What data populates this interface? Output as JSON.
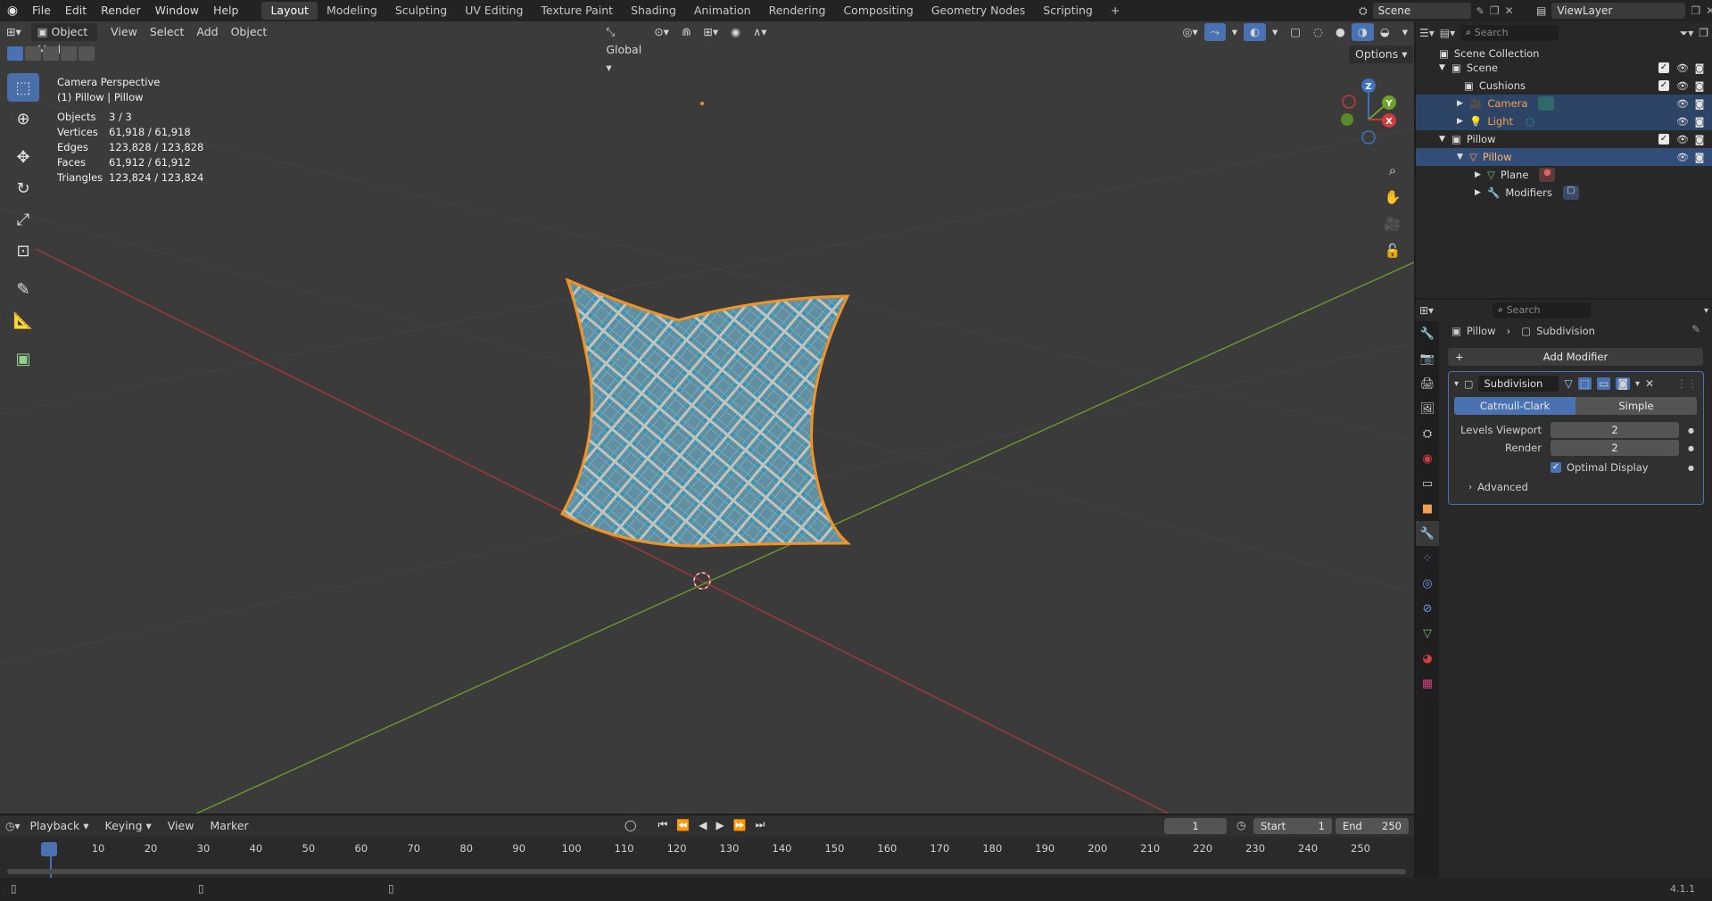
{
  "menu": [
    "File",
    "Edit",
    "Render",
    "Window",
    "Help"
  ],
  "workspaces": [
    "Layout",
    "Modeling",
    "Sculpting",
    "UV Editing",
    "Texture Paint",
    "Shading",
    "Animation",
    "Rendering",
    "Compositing",
    "Geometry Nodes",
    "Scripting"
  ],
  "active_workspace": "Layout",
  "plus_tab": "+",
  "scene_name": "Scene",
  "view_layer": "ViewLayer",
  "viewport": {
    "mode": "Object Mode",
    "menus": [
      "View",
      "Select",
      "Add",
      "Object"
    ],
    "transform_orientation": "Global",
    "options_label": "Options",
    "overlay_title": "Camera Perspective",
    "overlay_subtitle": "(1) Pillow | Pillow",
    "stats": [
      {
        "k": "Objects",
        "v": "3 / 3"
      },
      {
        "k": "Vertices",
        "v": "61,918 / 61,918"
      },
      {
        "k": "Edges",
        "v": "123,828 / 123,828"
      },
      {
        "k": "Faces",
        "v": "61,912 / 61,912"
      },
      {
        "k": "Triangles",
        "v": "123,824 / 123,824"
      }
    ],
    "gizmo_labels": {
      "z": "Z",
      "y": "Y",
      "x": "X"
    }
  },
  "outliner": {
    "search_placeholder": "Search",
    "root": "Scene Collection",
    "items": [
      {
        "label": "Scene"
      },
      {
        "label": "Cushions"
      },
      {
        "label": "Camera"
      },
      {
        "label": "Light"
      },
      {
        "label": "Pillow"
      },
      {
        "label": "Pillow"
      },
      {
        "label": "Plane"
      },
      {
        "label": "Modifiers"
      }
    ]
  },
  "properties": {
    "search_placeholder": "Search",
    "breadcrumb_object": "Pillow",
    "breadcrumb_modifier": "Subdivision",
    "add_modifier": "Add Modifier",
    "modifier_name": "Subdivision",
    "mode_catmull": "Catmull-Clark",
    "mode_simple": "Simple",
    "levels_viewport_label": "Levels Viewport",
    "levels_viewport_value": "2",
    "render_label": "Render",
    "render_value": "2",
    "optimal_display_label": "Optimal Display",
    "advanced_label": "Advanced"
  },
  "timeline": {
    "menus": [
      "Playback",
      "Keying",
      "View",
      "Marker"
    ],
    "current_frame": "1",
    "start_label": "Start",
    "start_value": "1",
    "end_label": "End",
    "end_value": "250",
    "ticks": [
      "1",
      "10",
      "20",
      "30",
      "40",
      "50",
      "60",
      "70",
      "80",
      "90",
      "100",
      "110",
      "120",
      "130",
      "140",
      "150",
      "160",
      "170",
      "180",
      "190",
      "200",
      "210",
      "220",
      "230",
      "240",
      "250"
    ]
  },
  "version": "4.1.1",
  "colors": {
    "accent": "#4a72b2",
    "selection_orange": "#f0901e",
    "x_axis": "#b93a3a",
    "y_axis": "#6e9a2a"
  }
}
